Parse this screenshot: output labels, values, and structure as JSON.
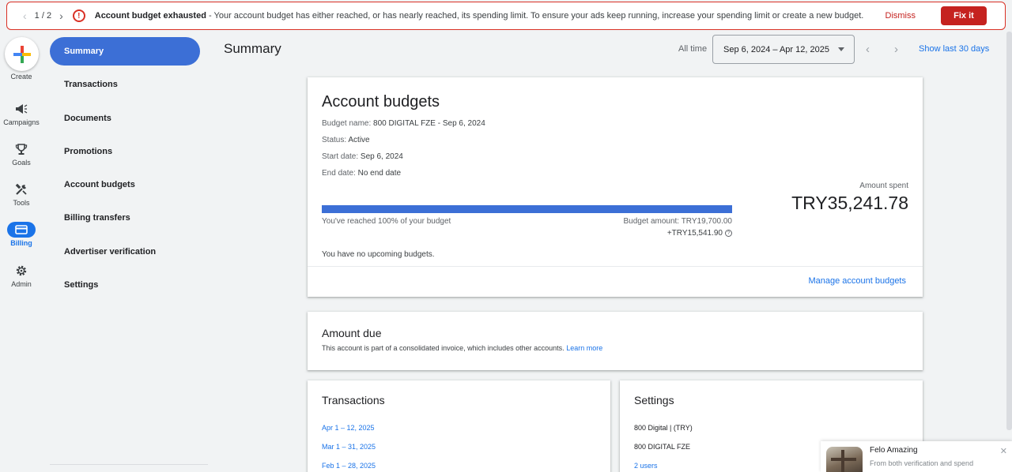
{
  "alert": {
    "counter": "1 / 2",
    "title": "Account budget exhausted",
    "message": " - Your account budget has either reached, or has nearly reached, its spending limit. To ensure your ads keep running, increase your spending limit or create a new budget.",
    "dismiss_label": "Dismiss",
    "fix_label": "Fix it",
    "accent_color": "#c5221f"
  },
  "rail": {
    "create_label": "Create",
    "items": [
      {
        "label": "Campaigns",
        "icon": "megaphone-icon"
      },
      {
        "label": "Goals",
        "icon": "trophy-icon"
      },
      {
        "label": "Tools",
        "icon": "tools-icon"
      },
      {
        "label": "Billing",
        "icon": "credit-card-icon",
        "active": true
      },
      {
        "label": "Admin",
        "icon": "gear-icon"
      }
    ]
  },
  "sidenav": {
    "items": [
      {
        "label": "Summary",
        "active": true
      },
      {
        "label": "Transactions"
      },
      {
        "label": "Documents"
      },
      {
        "label": "Promotions"
      },
      {
        "label": "Account budgets"
      },
      {
        "label": "Billing transfers"
      },
      {
        "label": "Advertiser verification"
      },
      {
        "label": "Settings"
      }
    ]
  },
  "header": {
    "title": "Summary",
    "range_label": "All time",
    "date_range": "Sep 6, 2024 – Apr 12, 2025",
    "show_last": "Show last 30 days"
  },
  "budgets": {
    "title": "Account budgets",
    "name_key": "Budget name:",
    "name_val": "800 DIGITAL FZE - Sep 6, 2024",
    "status_key": "Status:",
    "status_val": "Active",
    "start_key": "Start date:",
    "start_val": "Sep 6, 2024",
    "end_key": "End date:",
    "end_val": "No end date",
    "amount_spent_label": "Amount spent",
    "amount_spent": "TRY35,241.78",
    "progress_percent": 100,
    "reached_text": "You've reached 100% of your budget",
    "budget_amount": "Budget amount: TRY19,700.00",
    "overage": "+TRY15,541.90",
    "no_upcoming": "You have no upcoming budgets.",
    "manage_label": "Manage account budgets"
  },
  "amount_due": {
    "title": "Amount due",
    "description": "This account is part of a consolidated invoice, which includes other accounts.",
    "learn_more": "Learn more"
  },
  "transactions": {
    "title": "Transactions",
    "links": [
      "Apr 1 – 12, 2025",
      "Mar 1 – 31, 2025",
      "Feb 1 – 28, 2025"
    ]
  },
  "settings": {
    "title": "Settings",
    "rows": [
      "800 Digital | (TRY)",
      "800 DIGITAL FZE"
    ],
    "users_link": "2 users"
  },
  "toast": {
    "title": "Felo Amazing",
    "subtitle": "From both verification and spend"
  }
}
